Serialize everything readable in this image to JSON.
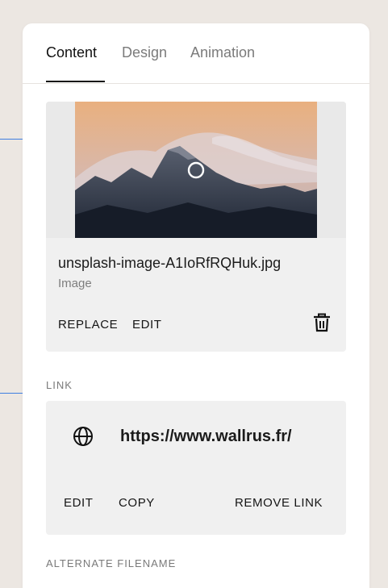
{
  "tabs": [
    {
      "label": "Content",
      "active": true
    },
    {
      "label": "Design",
      "active": false
    },
    {
      "label": "Animation",
      "active": false
    }
  ],
  "image": {
    "filename": "unsplash-image-A1IoRfRQHuk.jpg",
    "type_label": "Image",
    "replace_label": "REPLACE",
    "edit_label": "EDIT",
    "delete_icon": "trash-icon",
    "focal_point_icon": "circle-icon"
  },
  "link": {
    "section_label": "LINK",
    "icon": "globe-icon",
    "url": "https://www.wallrus.fr/",
    "edit_label": "EDIT",
    "copy_label": "COPY",
    "remove_label": "REMOVE LINK"
  },
  "next_section_label": "ALTERNATE FILENAME",
  "colors": {
    "background": "#ece7e2",
    "panel": "#ffffff",
    "card": "#f0f0f0",
    "guide_line": "#3f7fe0",
    "text": "#111111",
    "muted": "#7b7b7b"
  }
}
